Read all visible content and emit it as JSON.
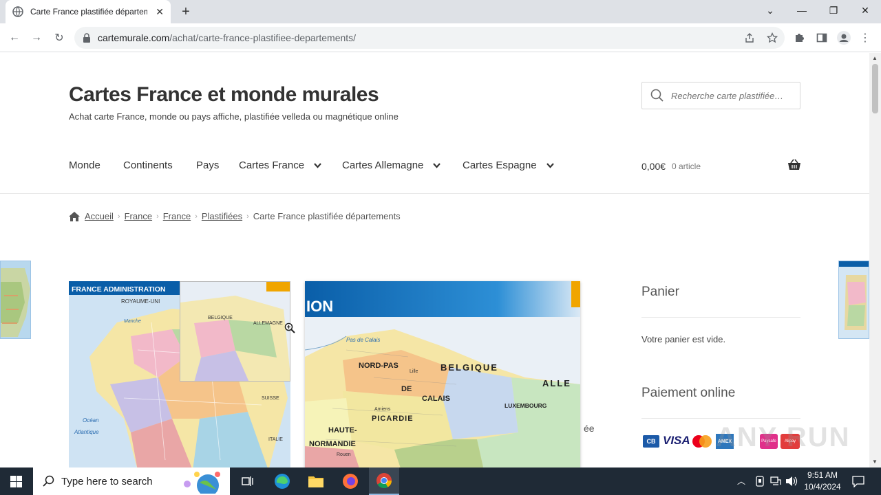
{
  "browser": {
    "tab_title": "Carte France plastifiée départem",
    "new_tab": "+",
    "url_host": "cartemurale.com",
    "url_path": "/achat/carte-france-plastifiee-departements/"
  },
  "site": {
    "title": "Cartes France et monde murales",
    "description": "Achat carte France, monde ou pays affiche, plastifiée velleda ou magnétique online",
    "search_placeholder": "Recherche carte plastifiée…"
  },
  "menu": [
    {
      "label": "Monde"
    },
    {
      "label": "Continents"
    },
    {
      "label": "Pays"
    },
    {
      "label": "Cartes France"
    },
    {
      "label": "Cartes Allemagne"
    },
    {
      "label": "Cartes Espagne"
    }
  ],
  "cart": {
    "total": "0,00€",
    "count": "0 article"
  },
  "breadcrumb": {
    "items": [
      "Accueil",
      "France",
      "France",
      "Plastifiées"
    ],
    "current": "Carte France plastifiée départements"
  },
  "product": {
    "thumb_title": "FRANCE ADMINISTRATION",
    "thumb_labels": [
      "ROYAUME-UNI",
      "Manche",
      "Océan",
      "Atlantique",
      "SUISSE",
      "ITALIE"
    ],
    "lens_labels": [
      "BELGIQUE",
      "ALLEMAGNE"
    ],
    "zoom_title": "ION",
    "zoom_labels": [
      "BELGIQUE",
      "ALLE",
      "LUXEMBOURG",
      "NORD-PAS",
      "DE",
      "CALAIS",
      "PICARDIE",
      "HAUTE-",
      "NORMANDIE",
      "Pas de Calais",
      "Amiens",
      "Lille",
      "Rouen"
    ],
    "partial_text": "ée"
  },
  "sidebar": {
    "cart_heading": "Panier",
    "cart_empty": "Votre panier est vide.",
    "payment_heading": "Paiement online",
    "payment_logos": [
      "CB",
      "VISA",
      "MasterCard",
      "AMEX",
      "Paysafe",
      "Alipay"
    ]
  },
  "watermark": "ANY RUN",
  "taskbar": {
    "search_placeholder": "Type here to search",
    "time": "9:51 AM",
    "date": "10/4/2024"
  },
  "colors": {
    "accent": "#333333",
    "map_blue": "#0a5ea8",
    "map_yellow": "#f5e6a6"
  }
}
